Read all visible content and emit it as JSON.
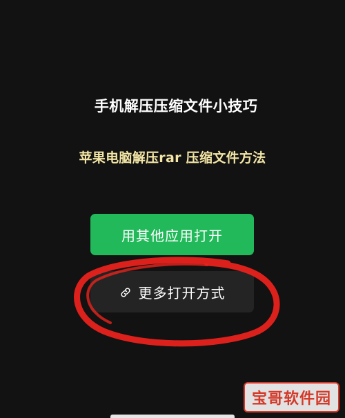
{
  "overlay": {
    "title": "手机解压压缩文件小技巧",
    "subtitle": "苹果电脑解压rar 压缩文件方法"
  },
  "actions": {
    "open_with_other_app": "用其他应用打开",
    "more_open_methods": "更多打开方式"
  },
  "icons": {
    "more_open_methods_icon": "link-icon"
  },
  "watermark": {
    "text": "宝哥软件园"
  },
  "colors": {
    "background": "#121212",
    "primary_button": "#21b95a",
    "secondary_button": "#242424",
    "subtitle_text": "#f3e6a6",
    "annotation_circle": "#e8231d"
  }
}
